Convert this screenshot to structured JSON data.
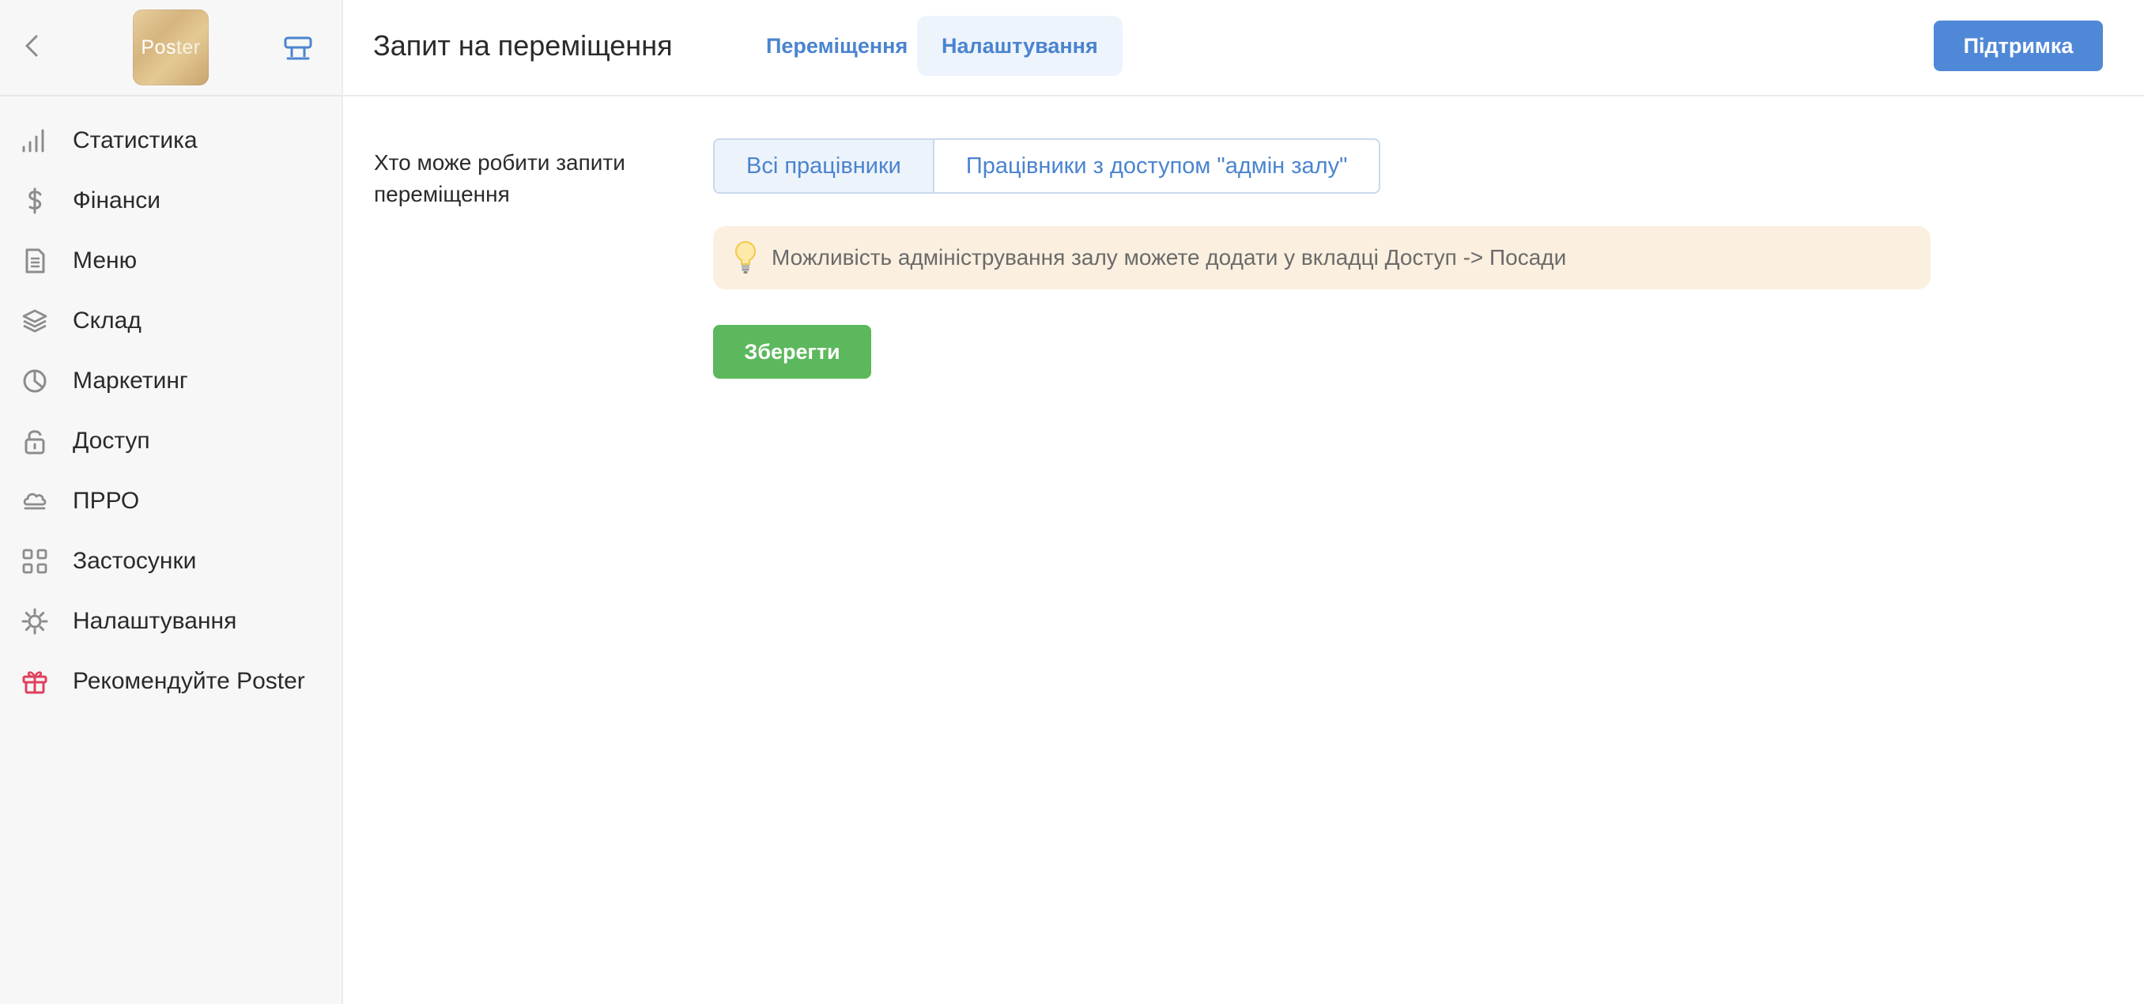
{
  "colors": {
    "accent": "#5088d8",
    "link": "#4a84cf",
    "success": "#5cb85c",
    "hint_bg": "#fbefdf",
    "sidebar_bg": "#f7f7f7",
    "gift_icon": "#e0405e"
  },
  "sidebar": {
    "back_icon": "chevron-left-icon",
    "logo": {
      "part1": "Pos",
      "part2": "ter"
    },
    "pos_icon": "terminal-icon",
    "items": [
      {
        "label": "Статистика",
        "icon": "bar-chart-icon"
      },
      {
        "label": "Фінанси",
        "icon": "dollar-icon"
      },
      {
        "label": "Меню",
        "icon": "document-icon"
      },
      {
        "label": "Склад",
        "icon": "layers-icon"
      },
      {
        "label": "Маркетинг",
        "icon": "pie-chart-icon"
      },
      {
        "label": "Доступ",
        "icon": "lock-icon"
      },
      {
        "label": "ПРРО",
        "icon": "cloud-icon"
      },
      {
        "label": "Застосунки",
        "icon": "apps-grid-icon"
      },
      {
        "label": "Налаштування",
        "icon": "gear-icon"
      },
      {
        "label": "Рекомендуйте Poster",
        "icon": "gift-icon"
      }
    ]
  },
  "header": {
    "title": "Запит на переміщення",
    "tabs": [
      {
        "label": "Переміщення",
        "active": false
      },
      {
        "label": "Налаштування",
        "active": true
      }
    ],
    "support_label": "Підтримка"
  },
  "main": {
    "field_label": "Хто може робити запити переміщення",
    "options": [
      {
        "label": "Всі працівники",
        "selected": true
      },
      {
        "label": "Працівники з доступом \"адмін залу\"",
        "selected": false
      }
    ],
    "hint_icon": "lightbulb-icon",
    "hint_text": "Можливість адміністрування залу можете додати у вкладці Доступ -> Посади",
    "save_label": "Зберегти"
  }
}
